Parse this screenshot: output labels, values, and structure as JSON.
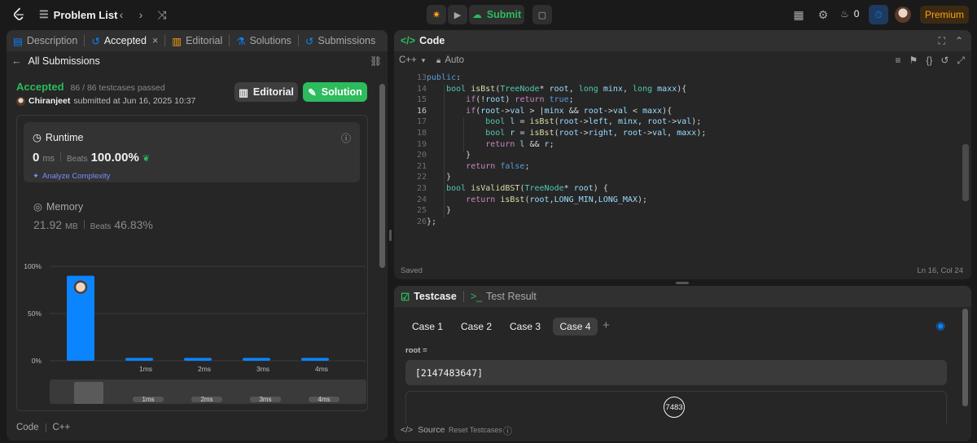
{
  "topbar": {
    "problem_list": "Problem List",
    "submit": "Submit",
    "streak_count": "0",
    "premium": "Premium"
  },
  "left_tabs": [
    {
      "label": "Description"
    },
    {
      "label": "Accepted"
    },
    {
      "label": "Editorial"
    },
    {
      "label": "Solutions"
    },
    {
      "label": "Submissions"
    }
  ],
  "submission": {
    "back_label": "All Submissions",
    "status": "Accepted",
    "testcases": "86 / 86 testcases passed",
    "user": "Chiranjeet",
    "submitted_text": "submitted at Jun 16, 2025 10:37",
    "editorial_btn": "Editorial",
    "solution_btn": "Solution"
  },
  "runtime": {
    "title": "Runtime",
    "value": "0",
    "unit": "ms",
    "beats_label": "Beats",
    "beats_value": "100.00%",
    "analyze": "Analyze Complexity"
  },
  "memory": {
    "title": "Memory",
    "value": "21.92",
    "unit": "MB",
    "beats_label": "Beats",
    "beats_value": "46.83%"
  },
  "chart_data": {
    "type": "bar",
    "categories": [
      "0ms",
      "1ms",
      "2ms",
      "3ms",
      "4ms"
    ],
    "tick_labels": [
      "",
      "1ms",
      "2ms",
      "3ms",
      "4ms"
    ],
    "values": [
      90,
      3,
      3,
      3,
      3
    ],
    "yticks": [
      "100%",
      "50%",
      "0%"
    ],
    "ylim": [
      0,
      100
    ],
    "grid": true
  },
  "minimap": {
    "labels": [
      "1ms",
      "2ms",
      "3ms",
      "4ms"
    ]
  },
  "left_footer": {
    "lang": "Code",
    "lang2": "C++"
  },
  "code_panel": {
    "title": "Code",
    "language": "C++",
    "mode": "Auto",
    "saved": "Saved",
    "cursor": "Ln 16, Col 24",
    "line_numbers": [
      "13",
      "14",
      "15",
      "16",
      "17",
      "18",
      "19",
      "20",
      "21",
      "22",
      "23",
      "24",
      "25",
      "26"
    ]
  },
  "testcase_panel": {
    "tab1": "Testcase",
    "tab2": "Test Result",
    "cases": [
      "Case 1",
      "Case 2",
      "Case 3",
      "Case 4"
    ],
    "param_label": "root =",
    "param_value": "[2147483647]",
    "tree_node": "7483",
    "source": "Source",
    "reset": "Reset Testcases"
  },
  "colors": {
    "accent_green": "#2cbb5d",
    "accent_blue": "#0a84ff",
    "premium": "#ffa116"
  }
}
